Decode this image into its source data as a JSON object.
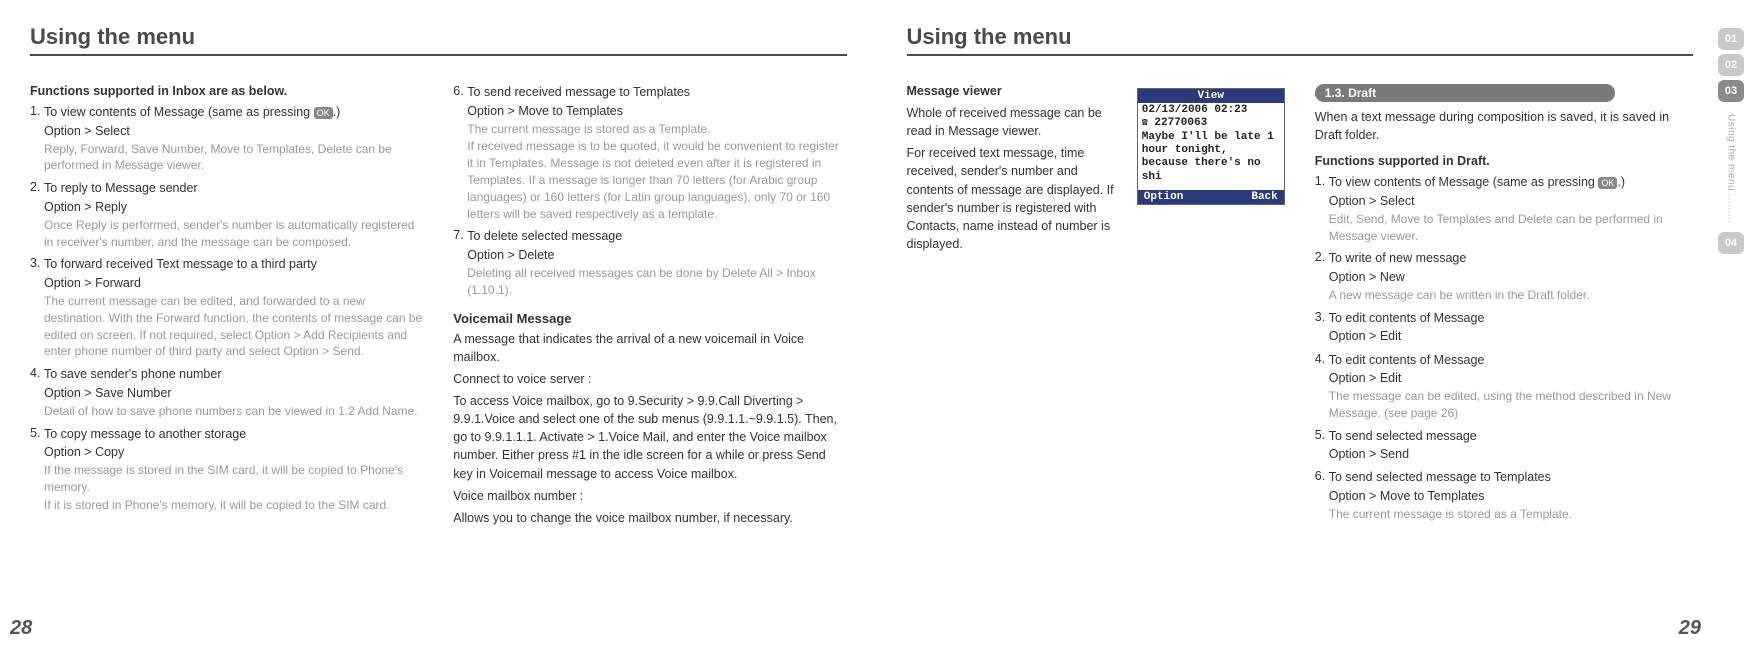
{
  "left": {
    "title": "Using the menu",
    "intro": "Functions supported in Inbox are as below.",
    "items": [
      {
        "n": "1.",
        "title": "To view contents of Message (same as pressing ",
        "titleSuffix": ".)",
        "option": "Option > Select",
        "desc": "Reply, Forward, Save Number, Move to Templates, Delete can be performed in Message viewer."
      },
      {
        "n": "2.",
        "title": "To reply to Message sender",
        "option": "Option > Reply",
        "desc": "Once Reply is performed, sender's number is automatically registered in receiver's number, and the message can be composed."
      },
      {
        "n": "3.",
        "title": "To forward received Text message to a third party",
        "option": "Option > Forward",
        "desc": "The current message can be edited, and forwarded to a new destination. With the Forward function, the contents of message can be edited on screen. If not required, select Option > Add Recipients and enter phone number of third party and select Option > Send."
      },
      {
        "n": "4.",
        "title": "To save sender's phone number",
        "option": "Option > Save Number",
        "desc": "Detail of how to save phone numbers can be viewed in 1.2 Add Name."
      },
      {
        "n": "5.",
        "title": "To copy message to another storage",
        "option": "Option > Copy",
        "desc": "If the message is stored in the SIM card, it will be copied to Phone's memory.",
        "desc2": "If it is stored in Phone's memory, it will be copied to the SIM card."
      }
    ],
    "col2": {
      "items": [
        {
          "n": "6.",
          "title": "To send received message to Templates",
          "option": "Option > Move to Templates",
          "desc": "The current message is stored as a Template.",
          "desc2": "If received message is to be quoted, it would be convenient to register it in Templates. Message is not deleted even after it is registered in Templates. If a message is longer than 70 letters (for Arabic group languages) or 160 letters (for Latin group languages), only 70 or 160 letters will be saved respectively as a template."
        },
        {
          "n": "7.",
          "title": "To delete selected message",
          "option": "Option > Delete",
          "desc": "Deleting all received messages can be done by Delete All > Inbox (1.10.1)."
        }
      ],
      "subhead": "Voicemail Message",
      "paras": [
        "A message that indicates the arrival of a new voicemail in Voice mailbox.",
        "Connect to voice server :",
        "To access Voice mailbox, go to 9.Security > 9.9.Call Diverting > 9.9.1.Voice and select one of the sub menus (9.9.1.1.~9.9.1.5). Then, go to 9.9.1.1.1. Activate > 1.Voice Mail, and enter the Voice mailbox number. Either press #1 in the idle screen for a while or press Send key in Voicemail message to access Voice mailbox.",
        "Voice mailbox number :",
        "Allows you to change the voice mailbox number, if necessary."
      ]
    },
    "pageNum": "28"
  },
  "right": {
    "title": "Using the menu",
    "viewer": {
      "head": "Message viewer",
      "body": "Whole of received message can be read in Message viewer.",
      "body2": "For received text message, time received, sender's number and contents of message are displayed. If sender's number is registered with Contacts, name instead of number is displayed."
    },
    "phone": {
      "bar": "View",
      "date": "02/13/2006 02:23",
      "number": "22770063",
      "msg": "Maybe I'll be late 1 hour tonight, because there's no shi",
      "left": "Option",
      "right": "Back"
    },
    "draft": {
      "pill": "1.3. Draft",
      "intro": "When a text message during composition is saved, it is saved in Draft folder.",
      "funcs": "Functions supported in Draft.",
      "items": [
        {
          "n": "1.",
          "title": "To view contents of Message (same as pressing ",
          "titleSuffix": ".)",
          "option": "Option > Select",
          "desc": "Edit, Send, Move to Templates and Delete can be performed in Message viewer."
        },
        {
          "n": "2.",
          "title": "To write of new message",
          "option": "Option > New",
          "desc": "A new message can be written in the Draft folder."
        },
        {
          "n": "3.",
          "title": "To edit contents of Message",
          "option": "Option > Edit"
        },
        {
          "n": "4.",
          "title": "To edit contents of Message",
          "option": "Option > Edit",
          "desc": "The message can be edited, using the method described in New Message. (see page 26)"
        },
        {
          "n": "5.",
          "title": "To send selected message",
          "option": "Option > Send"
        },
        {
          "n": "6.",
          "title": "To send selected message to Templates",
          "option": "Option > Move to Templates",
          "desc": "The current message is stored as a Template."
        }
      ]
    },
    "pageNum": "29",
    "tabs": [
      "01",
      "02",
      "03",
      "04"
    ],
    "tabLabel": "Using the menu ........."
  },
  "okBadge": "OK"
}
